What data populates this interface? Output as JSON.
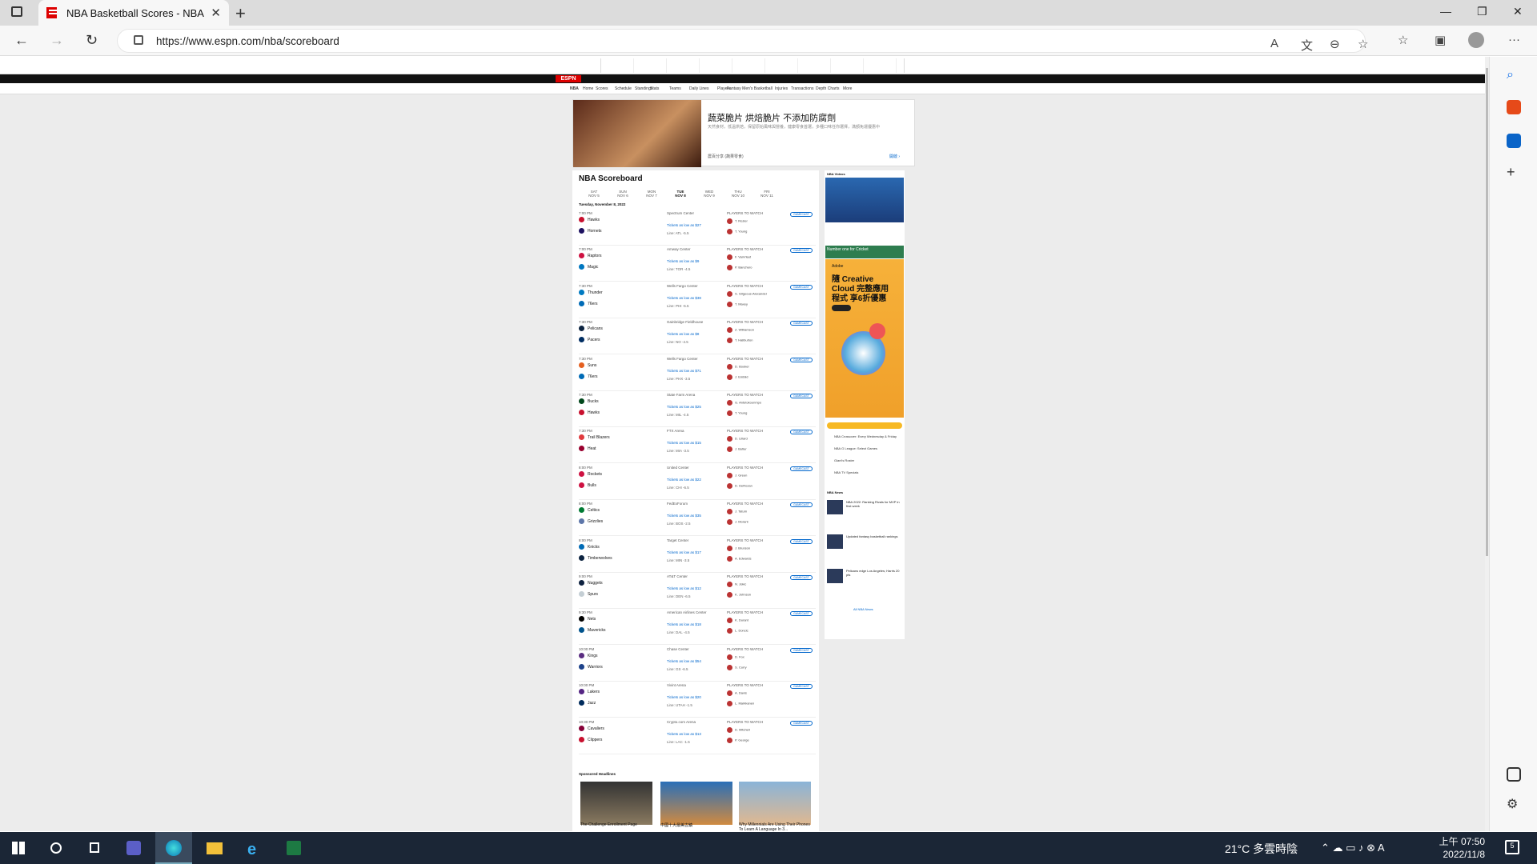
{
  "browser": {
    "tab_title": "NBA Basketball Scores - NBA Sc",
    "url": "https://www.espn.com/nba/scoreboard"
  },
  "espn": {
    "logo": "ESPN",
    "subnav": [
      "NBA",
      "Home",
      "Scores",
      "Schedule",
      "Standings",
      "Stats",
      "Teams",
      "Daily Lines",
      "Players",
      "Fantasy Men's Basketball",
      "Injuries",
      "Transactions",
      "Depth Charts",
      "More"
    ]
  },
  "ad_top": {
    "title": "蔬菜脆片 烘焙脆片 不添加防腐劑",
    "body": "天然食材，低溫烘焙，保留原始風味與營養，健康零食首選，多種口味任你選擇，滿額免運優惠中",
    "source": "農百分享 (蔬果零食)",
    "open_label": "開啟 ›"
  },
  "scoreboard": {
    "title": "NBA Scoreboard",
    "dates": [
      {
        "dow": "SAT",
        "day": "NOV 5"
      },
      {
        "dow": "SUN",
        "day": "NOV 6"
      },
      {
        "dow": "MON",
        "day": "NOV 7"
      },
      {
        "dow": "TUE",
        "day": "NOV 8"
      },
      {
        "dow": "WED",
        "day": "NOV 9"
      },
      {
        "dow": "THU",
        "day": "NOV 10"
      },
      {
        "dow": "FRI",
        "day": "NOV 11"
      }
    ],
    "day_header": "Tuesday, November 8, 2022",
    "players_label": "PLAYERS TO WATCH",
    "gamecast_label": "GAMECAST",
    "tickets_label": "Tickets as low as",
    "games": [
      {
        "time": "7:00 PM",
        "away": "Hawks",
        "home": "Hornets",
        "arena": "Spectrum Center",
        "price": "$27",
        "line": "Line: ATL -5.5",
        "p1": "T. Rozier",
        "p2": "T. Young",
        "ca": "#c8102e",
        "ch": "#1d1160"
      },
      {
        "time": "7:00 PM",
        "away": "Raptors",
        "home": "Magic",
        "arena": "Amway Center",
        "price": "$9",
        "line": "Line: TOR -4.5",
        "p1": "F. VanVleet",
        "p2": "P. Banchero",
        "ca": "#ce1141",
        "ch": "#0077c0"
      },
      {
        "time": "7:30 PM",
        "away": "Thunder",
        "home": "76ers",
        "arena": "Wells Fargo Center",
        "price": "$38",
        "line": "Line: PHI -5.5",
        "p1": "S. Gilgeous-Alexander",
        "p2": "T. Maxey",
        "ca": "#007ac1",
        "ch": "#006bb6"
      },
      {
        "time": "7:30 PM",
        "away": "Pelicans",
        "home": "Pacers",
        "arena": "Gainbridge Fieldhouse",
        "price": "$8",
        "line": "Line: NO -4.5",
        "p1": "Z. Williamson",
        "p2": "T. Haliburton",
        "ca": "#0c2340",
        "ch": "#002d62"
      },
      {
        "time": "7:30 PM",
        "away": "Suns",
        "home": "76ers",
        "arena": "Wells Fargo Center",
        "price": "$71",
        "line": "Line: PHX -3.5",
        "p1": "D. Booker",
        "p2": "J. Embiid",
        "ca": "#e56020",
        "ch": "#006bb6"
      },
      {
        "time": "7:30 PM",
        "away": "Bucks",
        "home": "Hawks",
        "arena": "State Farm Arena",
        "price": "$25",
        "line": "Line: MIL -4.5",
        "p1": "G. Antetokounmpo",
        "p2": "T. Young",
        "ca": "#00471b",
        "ch": "#c8102e"
      },
      {
        "time": "7:30 PM",
        "away": "Trail Blazers",
        "home": "Heat",
        "arena": "FTX Arena",
        "price": "$15",
        "line": "Line: MIA -3.5",
        "p1": "D. Lillard",
        "p2": "J. Butler",
        "ca": "#e03a3e",
        "ch": "#98002e"
      },
      {
        "time": "8:00 PM",
        "away": "Rockets",
        "home": "Bulls",
        "arena": "United Center",
        "price": "$22",
        "line": "Line: CHI -6.5",
        "p1": "J. Green",
        "p2": "D. DeRozan",
        "ca": "#ce1141",
        "ch": "#ce1141"
      },
      {
        "time": "8:00 PM",
        "away": "Celtics",
        "home": "Grizzlies",
        "arena": "FedExForum",
        "price": "$35",
        "line": "Line: BOS -2.5",
        "p1": "J. Tatum",
        "p2": "J. Morant",
        "ca": "#007a33",
        "ch": "#5d76a9"
      },
      {
        "time": "8:00 PM",
        "away": "Knicks",
        "home": "Timberwolves",
        "arena": "Target Center",
        "price": "$17",
        "line": "Line: MIN -3.5",
        "p1": "J. Brunson",
        "p2": "A. Edwards",
        "ca": "#006bb6",
        "ch": "#0c2340"
      },
      {
        "time": "9:00 PM",
        "away": "Nuggets",
        "home": "Spurs",
        "arena": "AT&T Center",
        "price": "$12",
        "line": "Line: DEN -6.5",
        "p1": "N. Jokic",
        "p2": "K. Johnson",
        "ca": "#0e2240",
        "ch": "#c4ced4"
      },
      {
        "time": "9:30 PM",
        "away": "Nets",
        "home": "Mavericks",
        "arena": "American Airlines Center",
        "price": "$18",
        "line": "Line: DAL -4.5",
        "p1": "K. Durant",
        "p2": "L. Doncic",
        "ca": "#000000",
        "ch": "#00538c"
      },
      {
        "time": "10:00 PM",
        "away": "Kings",
        "home": "Warriors",
        "arena": "Chase Center",
        "price": "$54",
        "line": "Line: GS -6.5",
        "p1": "D. Fox",
        "p2": "S. Curry",
        "ca": "#5a2d81",
        "ch": "#1d428a"
      },
      {
        "time": "10:00 PM",
        "away": "Lakers",
        "home": "Jazz",
        "arena": "Vivint Arena",
        "price": "$20",
        "line": "Line: UTAH -1.5",
        "p1": "A. Davis",
        "p2": "L. Markkanen",
        "ca": "#552583",
        "ch": "#002b5c"
      },
      {
        "time": "10:30 PM",
        "away": "Cavaliers",
        "home": "Clippers",
        "arena": "Crypto.com Arena",
        "price": "$13",
        "line": "Line: LAC -1.5",
        "p1": "D. Mitchell",
        "p2": "P. George",
        "ca": "#860038",
        "ch": "#c8102e"
      }
    ],
    "sponsored_label": "Sponsored Headlines",
    "sponsored": [
      "The Challenge Enrollment Page",
      "中國十大最美古鎮",
      "Why Millennials Are Using Their Phones To Learn A Language In 3..."
    ]
  },
  "rail": {
    "videos_label": "NBA Videos",
    "cricket_label": "Number one for Cricket",
    "cc_ad": "隨 Creative Cloud 完整應用程式 享6折優惠",
    "cc_brand": "Adobe",
    "links": [
      "NBA Crossover: Every Wednesday & Friday",
      "NBA G League: Select Games",
      "Giant's Roster",
      "NBA TV Specials"
    ],
    "news_label": "NBA News",
    "news": [
      "NBA 2022: Ranking Rivals for MVP in first week",
      "Updated fantasy basketball rankings",
      "Pelicans edge Los Angeles; Harris 20 pts"
    ],
    "all_news": "All NBA News"
  },
  "taskbar": {
    "weather": "21°C 多雲時陰",
    "time": "上午 07:50",
    "date": "2022/11/8"
  }
}
